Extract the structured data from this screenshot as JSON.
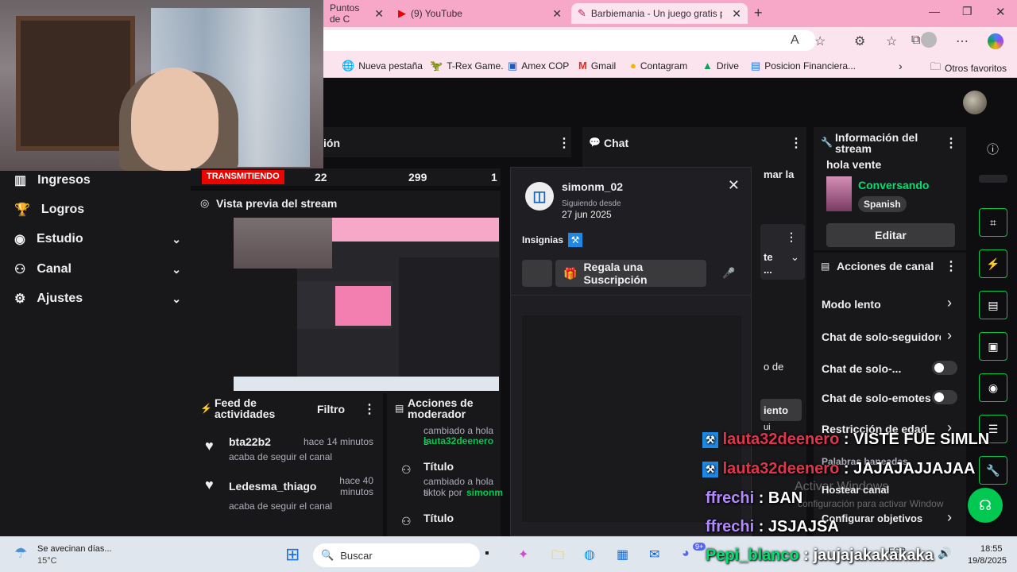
{
  "browser": {
    "tabs": [
      {
        "label": "Puntos de C"
      },
      {
        "label": "(9) YouTube"
      },
      {
        "label": "Barbiemania - Un juego gratis pa"
      }
    ],
    "new_tab_symbol": "+",
    "bookmarks": [
      {
        "label": "Nueva pestaña",
        "icon": "globe-icon"
      },
      {
        "label": "T-Rex Game.",
        "icon": "dino-icon"
      },
      {
        "label": "Amex COP",
        "icon": "card-icon"
      },
      {
        "label": "Gmail",
        "icon": "gmail-icon"
      },
      {
        "label": "Contagram",
        "icon": "app-icon"
      },
      {
        "label": "Drive",
        "icon": "drive-icon"
      },
      {
        "label": "Posicion Financiera...",
        "icon": "doc-icon"
      }
    ],
    "other_favorites": "Otros favoritos"
  },
  "sidebar": {
    "items": [
      {
        "label": "Ingresos",
        "icon": "chart-icon",
        "has_chevron": false
      },
      {
        "label": "Logros",
        "icon": "trophy-icon",
        "has_chevron": false
      },
      {
        "label": "Estudio",
        "icon": "studio-icon",
        "has_chevron": true
      },
      {
        "label": "Canal",
        "icon": "users-icon",
        "has_chevron": true
      },
      {
        "label": "Ajustes",
        "icon": "gear-icon",
        "has_chevron": true
      }
    ]
  },
  "stats": {
    "live_label": "TRANSMITIENDO",
    "viewers": "22",
    "followers": "299",
    "third": "1"
  },
  "panels": {
    "sesion_partial": "ión",
    "chat_title": "Chat",
    "preview_title": "Vista previa del stream",
    "feed_title": "Feed de actividades",
    "feed_filter": "Filtro",
    "mod_title": "Acciones de moderador",
    "info_title": "Información del stream"
  },
  "feed": [
    {
      "user": "bta22b2",
      "action": "acaba de seguir el canal",
      "time": "hace 14 minutos"
    },
    {
      "user": "Ledesma_thiago",
      "action": "acaba de seguir el canal",
      "time": "hace 40 minutos"
    }
  ],
  "mod_actions": [
    {
      "text1": "cambiado a hola s",
      "user": "lauta32deenero"
    },
    {
      "title": "Título",
      "text1": "cambiado a hola s",
      "text2": "tiktok por",
      "user": "simonm"
    },
    {
      "title": "Título"
    }
  ],
  "usercard": {
    "username": "simonm_02",
    "following_since_label": "Siguiendo desde",
    "following_since_date": "27 jun 2025",
    "badges_label": "Insignias",
    "gift_label": "Regala una Suscripción"
  },
  "chat_partials": {
    "line1": "mar la",
    "line2": "te",
    "line3": "...",
    "line4": "o de",
    "line5": "iento",
    "line6": "ui"
  },
  "stream_info": {
    "title": "hola vente",
    "category": "Conversando",
    "language": "Spanish",
    "edit_label": "Editar"
  },
  "channel_actions": {
    "title": "Acciones de canal",
    "rows": [
      {
        "label": "Modo lento",
        "type": "chevron"
      },
      {
        "label": "Chat de solo-seguidores",
        "type": "chevron"
      },
      {
        "label": "Chat de solo-...",
        "type": "toggle"
      },
      {
        "label": "Chat de solo-emotes",
        "type": "toggle"
      },
      {
        "label": "Restricción de edad",
        "type": "chevron"
      },
      {
        "label": "Palabras baneadas",
        "type": "chevron"
      },
      {
        "label": "Hostear canal",
        "type": "none"
      },
      {
        "label": "Configurar objetivos",
        "type": "chevron"
      }
    ]
  },
  "overlay_chat": [
    {
      "user": "lauta32deenero",
      "msg": "VISTE FUE SIMLN",
      "color": "#e0364d",
      "badge": true
    },
    {
      "user": "lauta32deenero",
      "msg": "JAJAJAJJAJAA",
      "color": "#e0364d",
      "badge": true
    },
    {
      "user": "ffrechi",
      "msg": "BAN",
      "color": "#b388ff",
      "badge": false
    },
    {
      "user": "ffrechi",
      "msg": "JSJAJSA",
      "color": "#b388ff",
      "badge": false
    },
    {
      "user": "Pepi_blanco",
      "msg": "jaujajakakakaka",
      "color": "#00e070",
      "badge": false
    }
  ],
  "windows_watermark": {
    "line1": "Activar Windows",
    "line2": "configuración para activar Window"
  },
  "taskbar": {
    "weather_text": "Se avecinan días...",
    "weather_temp": "15°C",
    "search_placeholder": "Buscar",
    "lang": "ESP",
    "time": "18:55",
    "date": "19/8/2025",
    "badge_count": "9+"
  },
  "colors": {
    "accent_green": "#00c850",
    "live_red": "#eb0400",
    "tab_pink": "#f7a8c9",
    "panel_bg": "#18181b"
  }
}
